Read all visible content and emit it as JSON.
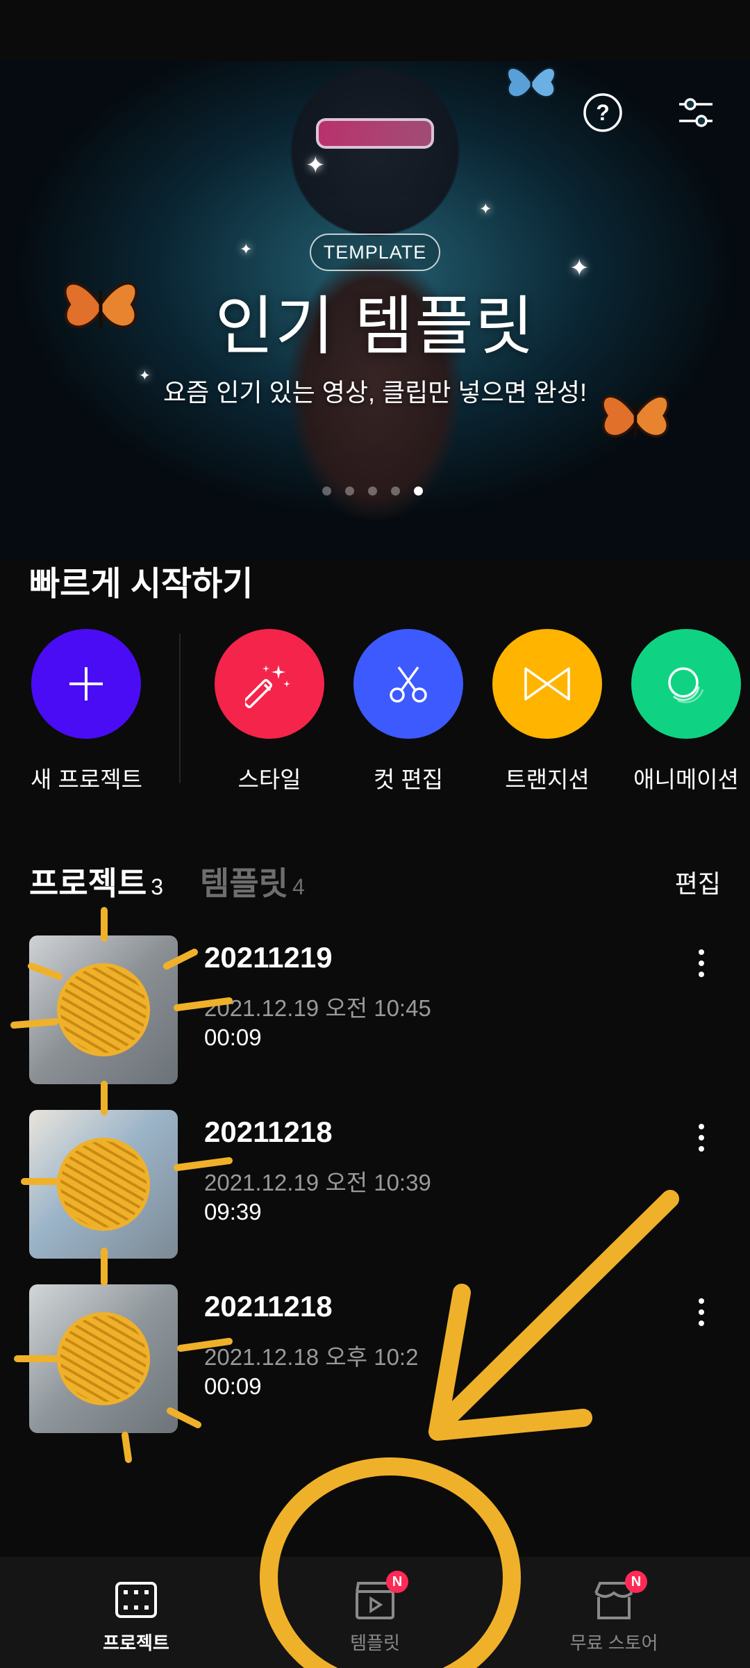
{
  "hero": {
    "badge": "TEMPLATE",
    "title": "인기 템플릿",
    "subtitle": "요즘 인기 있는 영상, 클립만 넣으면 완성!",
    "slides": 5,
    "active_slide": 5
  },
  "header_icons": {
    "help": "help-circle-icon",
    "settings": "sliders-icon"
  },
  "quick_start": {
    "title": "빠르게 시작하기",
    "items": [
      {
        "label": "새 프로젝트",
        "color": "#4a0cf5",
        "icon": "plus-icon"
      },
      {
        "label": "스타일",
        "color": "#f5244a",
        "icon": "magic-wand-icon"
      },
      {
        "label": "컷 편집",
        "color": "#3d5afe",
        "icon": "scissors-icon"
      },
      {
        "label": "트랜지션",
        "color": "#ffb400",
        "icon": "transition-icon"
      },
      {
        "label": "애니메이션",
        "color": "#0fd383",
        "icon": "animation-icon"
      }
    ]
  },
  "projects_tabs": {
    "projects_label": "프로젝트",
    "projects_count": "3",
    "templates_label": "템플릿",
    "templates_count": "4",
    "edit_label": "편집"
  },
  "projects": [
    {
      "name": "20211219",
      "date": "2021.12.19 오전 10:45",
      "duration": "00:09"
    },
    {
      "name": "20211218",
      "date": "2021.12.19 오전 10:39",
      "duration": "09:39"
    },
    {
      "name": "20211218",
      "date": "2021.12.18 오후 10:2",
      "duration": "00:09"
    }
  ],
  "bottom_nav": {
    "items": [
      {
        "label": "프로젝트",
        "icon": "film-icon",
        "active": true,
        "badge": ""
      },
      {
        "label": "템플릿",
        "icon": "clapperboard-icon",
        "active": false,
        "badge": "N"
      },
      {
        "label": "무료 스토어",
        "icon": "store-icon",
        "active": false,
        "badge": "N"
      }
    ]
  },
  "annotation_color": "#f0b12a"
}
